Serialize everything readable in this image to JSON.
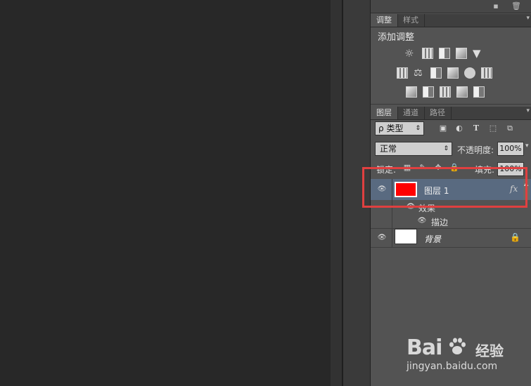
{
  "adjustments_panel": {
    "tabs": [
      {
        "label": "调整",
        "active": true
      },
      {
        "label": "样式",
        "active": false
      }
    ],
    "title": "添加调整"
  },
  "layers_panel": {
    "tabs": [
      {
        "label": "图层",
        "active": true
      },
      {
        "label": "通道",
        "active": false
      },
      {
        "label": "路径",
        "active": false
      }
    ],
    "filter_kind": "类型",
    "filter_kind_symbol": "ρ",
    "blend_mode": "正常",
    "opacity_label": "不透明度:",
    "opacity_value": "100%",
    "lock_label": "锁定:",
    "fill_label": "填充:",
    "fill_value": "100%",
    "layers": [
      {
        "name": "图层 1",
        "thumb_color": "#ff0000",
        "selected": true,
        "fx": "fx",
        "effects_label": "效果",
        "effects": [
          "描边"
        ]
      },
      {
        "name": "背景",
        "thumb_color": "#ffffff",
        "selected": false,
        "locked": true
      }
    ]
  },
  "watermark": {
    "logo_text": "Bai",
    "logo_suffix": "经验",
    "url": "jingyan.baidu.com"
  },
  "colors": {
    "selected_row": "#596a80",
    "highlight_box": "#e04040",
    "panel_bg": "#535353"
  }
}
